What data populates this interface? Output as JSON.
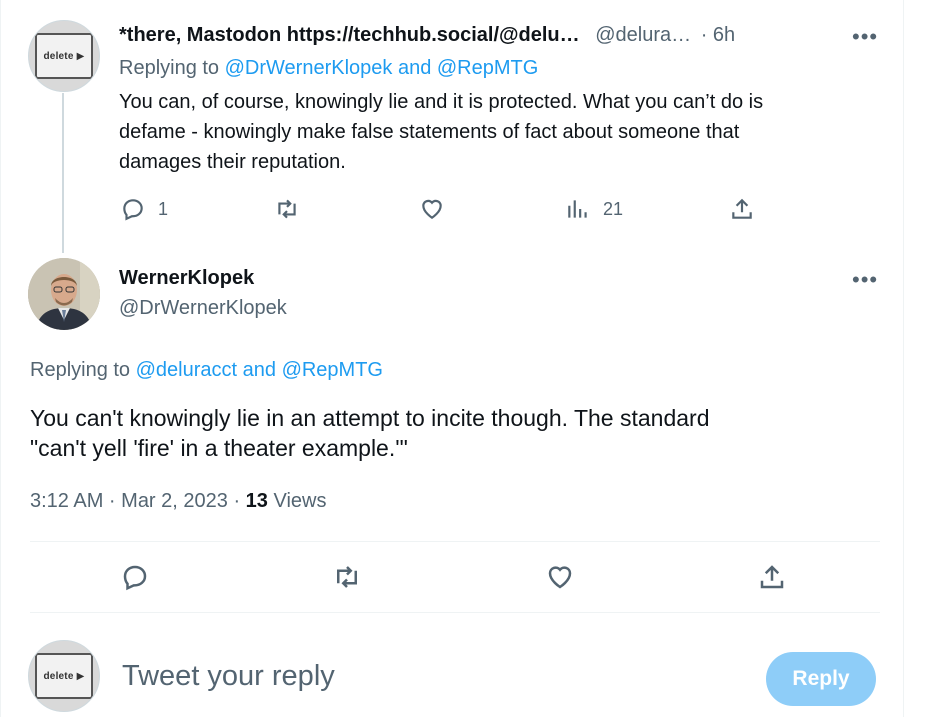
{
  "reply_tweet": {
    "display_name": "*there, Mastodon https://techhub.social/@delu…",
    "handle": "@delura…",
    "time": "· 6h",
    "replying_prefix": "Replying to",
    "replying_to": "@DrWernerKlopek and @RepMTG",
    "text_line1": "You can, of course, knowingly lie and it is protected. What you can’t do is",
    "text_line2": "defame - knowingly make false statements of fact about someone that",
    "text_line3": "damages their reputation.",
    "reply_count": "1",
    "views_count": "21",
    "avatar_label": "delete"
  },
  "main_tweet": {
    "display_name": "WernerKlopek",
    "handle": "@DrWernerKlopek",
    "replying_prefix": "Replying to",
    "replying_to": "@deluracct and @RepMTG",
    "text_line1": "You can't knowingly lie in an attempt to incite though. The standard",
    "text_line2": "\"can't yell 'fire' in a theater example.'\"",
    "timestamp": "3:12 AM · Mar 2, 2023 · ",
    "views_count": "13",
    "views_label": " Views"
  },
  "composer": {
    "placeholder": "Tweet your reply",
    "reply_button": "Reply",
    "avatar_label": "delete"
  },
  "more_glyph": "•••"
}
